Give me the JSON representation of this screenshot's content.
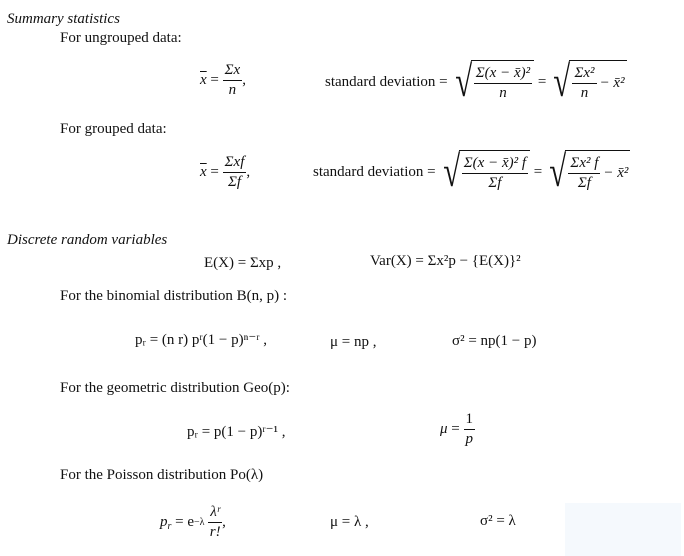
{
  "sections": {
    "summary": {
      "heading": "Summary statistics",
      "ungrouped_label": "For ungrouped data:",
      "grouped_label": "For grouped data:",
      "sd_label": "standard deviation",
      "ungrouped": {
        "mean_lhs": "x",
        "mean_num": "Σx",
        "mean_den": "n",
        "sd_form1_num": "Σ(x − x̄)²",
        "sd_form1_den": "n",
        "sd_form2_num": "Σx²",
        "sd_form2_den": "n",
        "sd_form2_tail": "− x̄²"
      },
      "grouped": {
        "mean_lhs": "x",
        "mean_num": "Σxf",
        "mean_den": "Σf",
        "sd_form1_num": "Σ(x − x̄)² f",
        "sd_form1_den": "Σf",
        "sd_form2_num": "Σx² f",
        "sd_form2_den": "Σf",
        "sd_form2_tail": "− x̄²"
      }
    },
    "discrete": {
      "heading": "Discrete random variables",
      "expectation": "E(X) = Σxp ,",
      "variance": "Var(X) = Σx²p − {E(X)}²",
      "binomial_label": "For the binomial distribution B(n, p) :",
      "binomial_pr": "pᵣ = (n r) pʳ(1 − p)ⁿ⁻ʳ ,",
      "binomial_mu": "μ = np ,",
      "binomial_var": "σ² = np(1 − p)",
      "geometric_label": "For the geometric distribution Geo(p):",
      "geometric_pr": "pᵣ = p(1 − p)ʳ⁻¹ ,",
      "geometric_mu_num": "1",
      "geometric_mu_den": "p",
      "poisson_label": "For the Poisson distribution Po(λ)",
      "poisson_num": "λʳ",
      "poisson_den": "r!",
      "poisson_mu": "μ = λ ,",
      "poisson_var": "σ² = λ"
    }
  }
}
